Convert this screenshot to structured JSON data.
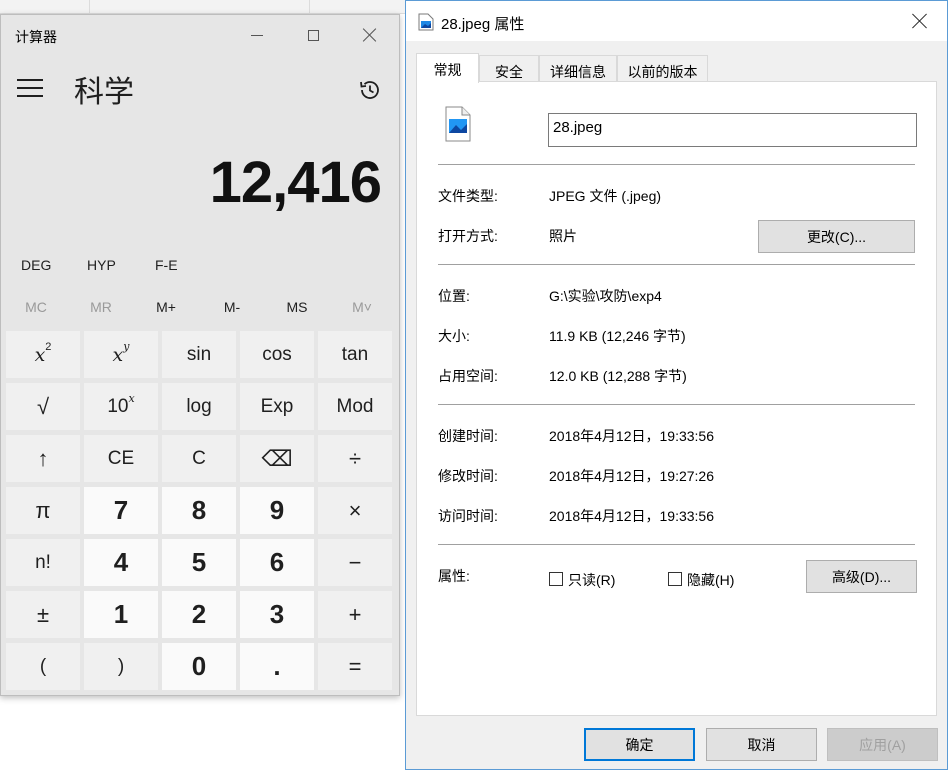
{
  "calculator": {
    "title": "计算器",
    "mode": "科学",
    "display": "12,416",
    "angle_row": [
      "DEG",
      "HYP",
      "F-E"
    ],
    "memory_row": [
      {
        "label": "MC",
        "enabled": false
      },
      {
        "label": "MR",
        "enabled": false
      },
      {
        "label": "M+",
        "enabled": true
      },
      {
        "label": "M-",
        "enabled": true
      },
      {
        "label": "MS",
        "enabled": true
      },
      {
        "label": "M˅",
        "enabled": false
      }
    ],
    "keys": {
      "sin": "sin",
      "cos": "cos",
      "tan": "tan",
      "log": "log",
      "exp": "Exp",
      "mod": "Mod",
      "sqrt": "√",
      "shift": "↑",
      "ce": "CE",
      "c": "C",
      "backspace": "⌫",
      "divide": "÷",
      "pi": "π",
      "seven": "7",
      "eight": "8",
      "nine": "9",
      "multiply": "×",
      "factorial": "n!",
      "four": "4",
      "five": "5",
      "six": "6",
      "minus": "−",
      "negate": "±",
      "one": "1",
      "two": "2",
      "three": "3",
      "plus": "+",
      "lparen": "(",
      "rparen": ")",
      "zero": "0",
      "decimal": ".",
      "equals": "="
    }
  },
  "properties": {
    "title": "28.jpeg 属性",
    "tabs": [
      "常规",
      "安全",
      "详细信息",
      "以前的版本"
    ],
    "filename": "28.jpeg",
    "file_type_label": "文件类型:",
    "file_type_value": "JPEG 文件 (.jpeg)",
    "opens_with_label": "打开方式:",
    "opens_with_value": "照片",
    "change_button": "更改(C)...",
    "location_label": "位置:",
    "location_value": "G:\\实验\\攻防\\exp4",
    "size_label": "大小:",
    "size_value": "11.9 KB (12,246 字节)",
    "disk_size_label": "占用空间:",
    "disk_size_value": "12.0 KB (12,288 字节)",
    "created_label": "创建时间:",
    "created_value": "2018年4月12日，19:33:56",
    "modified_label": "修改时间:",
    "modified_value": "2018年4月12日，19:27:26",
    "accessed_label": "访问时间:",
    "accessed_value": "2018年4月12日，19:33:56",
    "attributes_label": "属性:",
    "readonly_label": "只读(R)",
    "hidden_label": "隐藏(H)",
    "advanced_button": "高级(D)...",
    "ok_button": "确定",
    "cancel_button": "取消",
    "apply_button": "应用(A)"
  },
  "colors": {
    "dialog_border": "#5b9bd5",
    "primary_button_border": "#0078d7",
    "calc_background": "#e6e6e6"
  }
}
